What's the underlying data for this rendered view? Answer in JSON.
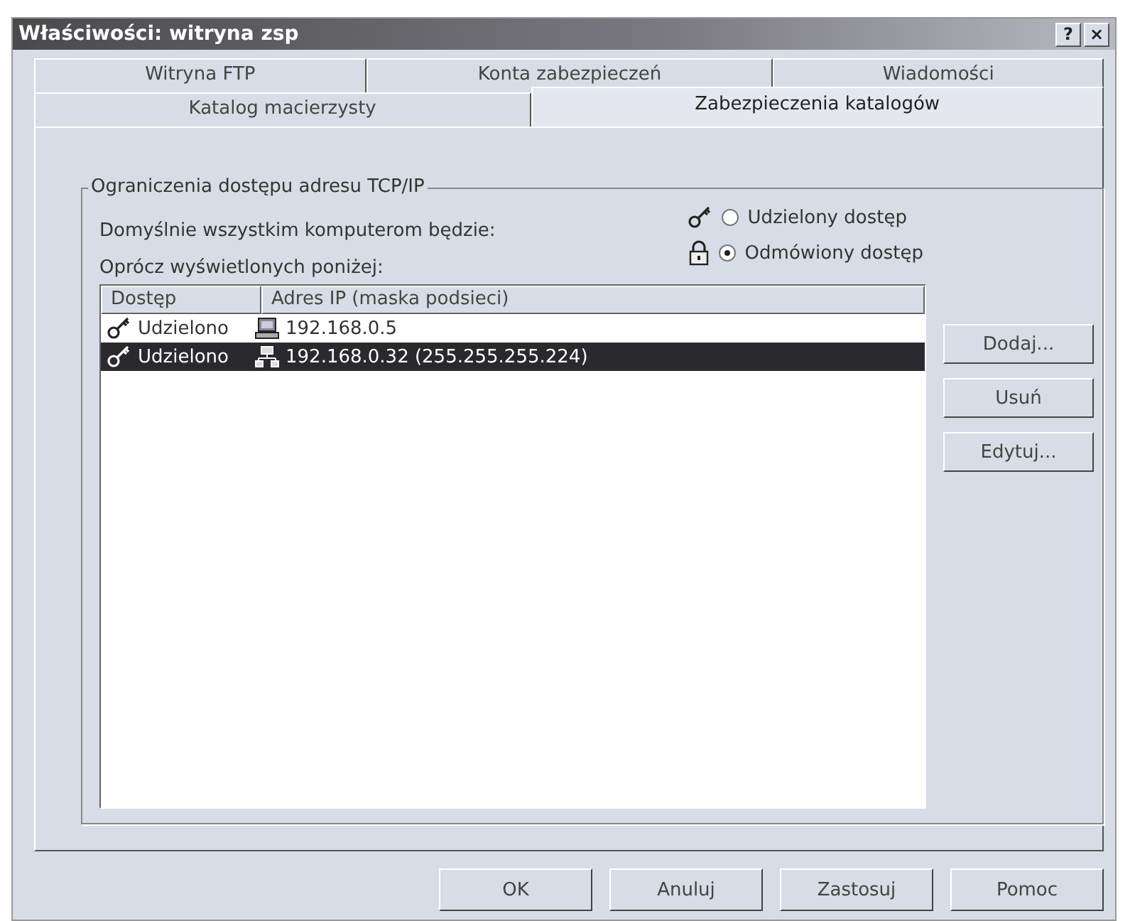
{
  "window": {
    "title": "Właściwości: witryna zsp",
    "title_buttons": [
      "?",
      "×"
    ]
  },
  "tab_rows": [
    {
      "tabs": [
        {
          "label": "Witryna FTP",
          "selected": false
        },
        {
          "label": "Konta zabezpieczeń",
          "selected": false
        },
        {
          "label": "Wiadomości",
          "selected": false
        }
      ]
    },
    {
      "tabs": [
        {
          "label": "Katalog macierzysty",
          "selected": false
        },
        {
          "label": "Zabezpieczenia katalogów",
          "selected": true
        }
      ]
    }
  ],
  "group": {
    "title": "Ograniczenia dostępu adresu TCP/IP",
    "default_label": "Domyślnie wszystkim komputerom będzie:",
    "options": [
      {
        "label": "Udzielony dostęp",
        "kind": "key",
        "selected": false
      },
      {
        "label": "Odmówiony dostęp",
        "kind": "lock",
        "selected": true
      }
    ],
    "except_label": "Oprócz  wyświetlonych poniżej:",
    "columns": [
      "Dostęp",
      "Adres IP (maska podsieci)"
    ],
    "rows": [
      {
        "access": "Udzielono",
        "address": "192.168.0.5",
        "kind": "computer",
        "selected": false
      },
      {
        "access": "Udzielono",
        "address": "192.168.0.32 (255.255.255.224)",
        "kind": "group",
        "selected": true
      }
    ],
    "buttons": [
      "Dodaj...",
      "Usuń",
      "Edytuj..."
    ]
  },
  "footer_buttons": [
    "OK",
    "Anuluj",
    "Zastosuj",
    "Pomoc"
  ]
}
